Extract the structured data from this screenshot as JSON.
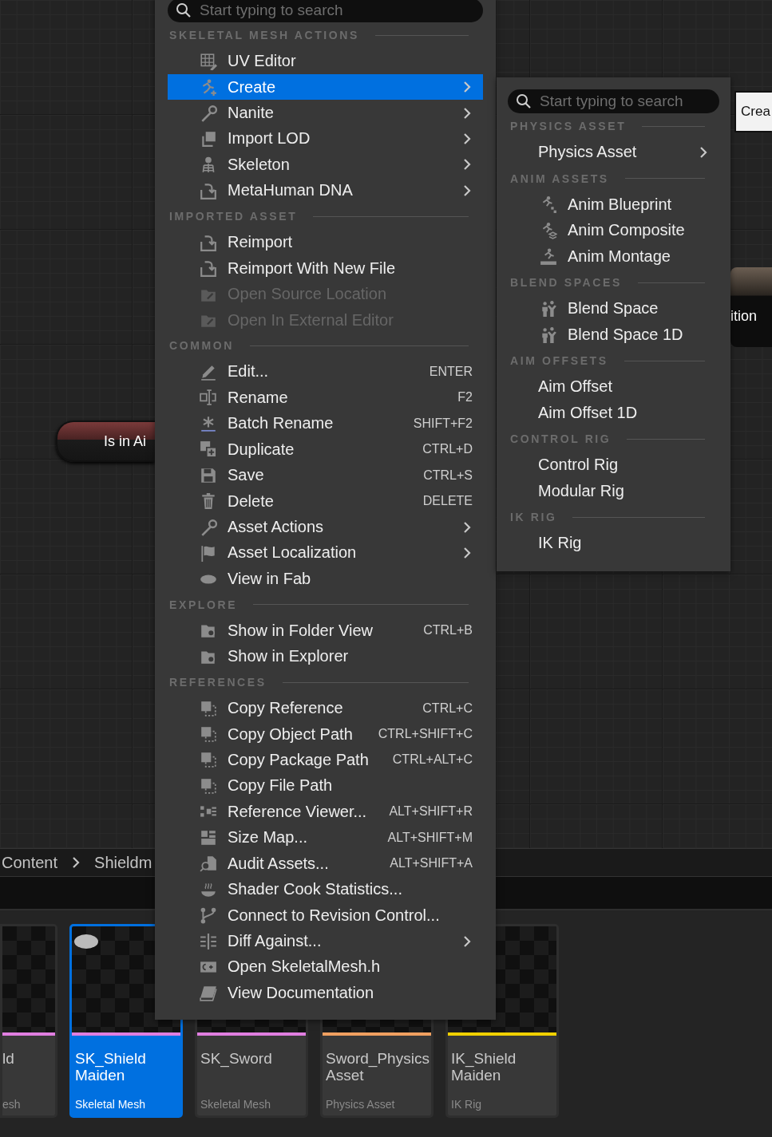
{
  "graph_nodes": [
    {
      "kind": "pill",
      "label": "Is in Ai"
    },
    {
      "kind": "panel",
      "label": "ition"
    },
    {
      "kind": "button",
      "label": "Crea"
    }
  ],
  "context_menu": {
    "search": {
      "placeholder": "Start typing to search"
    },
    "sections": [
      {
        "heading": "SKELETAL MESH ACTIONS",
        "items": [
          {
            "label": "UV Editor",
            "selected": false,
            "disabled": false,
            "has_submenu": false
          },
          {
            "label": "Create",
            "selected": true,
            "disabled": false,
            "has_submenu": true
          },
          {
            "label": "Nanite",
            "selected": false,
            "disabled": false,
            "has_submenu": true
          },
          {
            "label": "Import LOD",
            "selected": false,
            "disabled": false,
            "has_submenu": true
          },
          {
            "label": "Skeleton",
            "selected": false,
            "disabled": false,
            "has_submenu": true
          },
          {
            "label": "MetaHuman DNA",
            "selected": false,
            "disabled": false,
            "has_submenu": true
          }
        ]
      },
      {
        "heading": "IMPORTED ASSET",
        "items": [
          {
            "label": "Reimport",
            "selected": false,
            "disabled": false,
            "has_submenu": false
          },
          {
            "label": "Reimport With New File",
            "selected": false,
            "disabled": false,
            "has_submenu": false
          },
          {
            "label": "Open Source Location",
            "selected": false,
            "disabled": true,
            "has_submenu": false
          },
          {
            "label": "Open In External Editor",
            "selected": false,
            "disabled": true,
            "has_submenu": false
          }
        ]
      },
      {
        "heading": "COMMON",
        "items": [
          {
            "label": "Edit...",
            "shortcut": "ENTER",
            "selected": false,
            "disabled": false,
            "has_submenu": false
          },
          {
            "label": "Rename",
            "shortcut": "F2",
            "selected": false,
            "disabled": false,
            "has_submenu": false
          },
          {
            "label": "Batch Rename",
            "shortcut": "SHIFT+F2",
            "selected": false,
            "disabled": false,
            "has_submenu": false
          },
          {
            "label": "Duplicate",
            "shortcut": "CTRL+D",
            "selected": false,
            "disabled": false,
            "has_submenu": false
          },
          {
            "label": "Save",
            "shortcut": "CTRL+S",
            "selected": false,
            "disabled": false,
            "has_submenu": false
          },
          {
            "label": "Delete",
            "shortcut": "DELETE",
            "selected": false,
            "disabled": false,
            "has_submenu": false
          },
          {
            "label": "Asset Actions",
            "selected": false,
            "disabled": false,
            "has_submenu": true
          },
          {
            "label": "Asset Localization",
            "selected": false,
            "disabled": false,
            "has_submenu": true
          },
          {
            "label": "View in Fab",
            "selected": false,
            "disabled": false,
            "has_submenu": false
          }
        ]
      },
      {
        "heading": "EXPLORE",
        "items": [
          {
            "label": "Show in Folder View",
            "shortcut": "CTRL+B",
            "selected": false,
            "disabled": false,
            "has_submenu": false
          },
          {
            "label": "Show in Explorer",
            "selected": false,
            "disabled": false,
            "has_submenu": false
          }
        ]
      },
      {
        "heading": "REFERENCES",
        "items": [
          {
            "label": "Copy Reference",
            "shortcut": "CTRL+C",
            "selected": false,
            "disabled": false,
            "has_submenu": false
          },
          {
            "label": "Copy Object Path",
            "shortcut": "CTRL+SHIFT+C",
            "selected": false,
            "disabled": false,
            "has_submenu": false
          },
          {
            "label": "Copy Package Path",
            "shortcut": "CTRL+ALT+C",
            "selected": false,
            "disabled": false,
            "has_submenu": false
          },
          {
            "label": "Copy File Path",
            "selected": false,
            "disabled": false,
            "has_submenu": false
          },
          {
            "label": "Reference Viewer...",
            "shortcut": "ALT+SHIFT+R",
            "selected": false,
            "disabled": false,
            "has_submenu": false
          },
          {
            "label": "Size Map...",
            "shortcut": "ALT+SHIFT+M",
            "selected": false,
            "disabled": false,
            "has_submenu": false
          },
          {
            "label": "Audit Assets...",
            "shortcut": "ALT+SHIFT+A",
            "selected": false,
            "disabled": false,
            "has_submenu": false
          },
          {
            "label": "Shader Cook Statistics...",
            "selected": false,
            "disabled": false,
            "has_submenu": false
          },
          {
            "label": "Connect to Revision Control...",
            "selected": false,
            "disabled": false,
            "has_submenu": false
          },
          {
            "label": "Diff Against...",
            "selected": false,
            "disabled": false,
            "has_submenu": true
          },
          {
            "label": "Open SkeletalMesh.h",
            "selected": false,
            "disabled": false,
            "has_submenu": false
          },
          {
            "label": "View Documentation",
            "selected": false,
            "disabled": false,
            "has_submenu": false
          }
        ]
      }
    ]
  },
  "submenu": {
    "search": {
      "placeholder": "Start typing to search"
    },
    "sections": [
      {
        "heading": "PHYSICS ASSET",
        "items": [
          {
            "label": "Physics Asset",
            "selected": false,
            "disabled": false,
            "has_submenu": true
          }
        ]
      },
      {
        "heading": "ANIM ASSETS",
        "items": [
          {
            "label": "Anim Blueprint",
            "selected": false,
            "disabled": false,
            "has_submenu": false
          },
          {
            "label": "Anim Composite",
            "selected": false,
            "disabled": false,
            "has_submenu": false
          },
          {
            "label": "Anim Montage",
            "selected": false,
            "disabled": false,
            "has_submenu": false
          }
        ]
      },
      {
        "heading": "BLEND SPACES",
        "items": [
          {
            "label": "Blend Space",
            "selected": false,
            "disabled": false,
            "has_submenu": false
          },
          {
            "label": "Blend Space 1D",
            "selected": false,
            "disabled": false,
            "has_submenu": false
          }
        ]
      },
      {
        "heading": "AIM OFFSETS",
        "items": [
          {
            "label": "Aim Offset",
            "selected": false,
            "disabled": false,
            "has_submenu": false
          },
          {
            "label": "Aim Offset 1D",
            "selected": false,
            "disabled": false,
            "has_submenu": false
          }
        ]
      },
      {
        "heading": "CONTROL RIG",
        "items": [
          {
            "label": "Control Rig",
            "selected": false,
            "disabled": false,
            "has_submenu": false
          },
          {
            "label": "Modular Rig",
            "selected": false,
            "disabled": false,
            "has_submenu": false
          }
        ]
      },
      {
        "heading": "IK RIG",
        "items": [
          {
            "label": "IK Rig",
            "selected": false,
            "disabled": false,
            "has_submenu": false
          }
        ]
      }
    ]
  },
  "breadcrumb": [
    "Content",
    "Shieldm"
  ],
  "assets": [
    {
      "name": "ld",
      "type": "esh",
      "color": "#e07ee0",
      "selected": false
    },
    {
      "name": "SK_Shield Maiden",
      "type": "Skeletal Mesh",
      "color": "#e07ee0",
      "selected": true
    },
    {
      "name": "SK_Sword",
      "type": "Skeletal Mesh",
      "color": "#e07ee0",
      "selected": false
    },
    {
      "name": "Sword_Physics Asset",
      "type": "Physics Asset",
      "color": "#f0a060",
      "selected": false
    },
    {
      "name": "IK_Shield Maiden",
      "type": "IK Rig",
      "color": "#f0d000",
      "selected": false
    }
  ]
}
